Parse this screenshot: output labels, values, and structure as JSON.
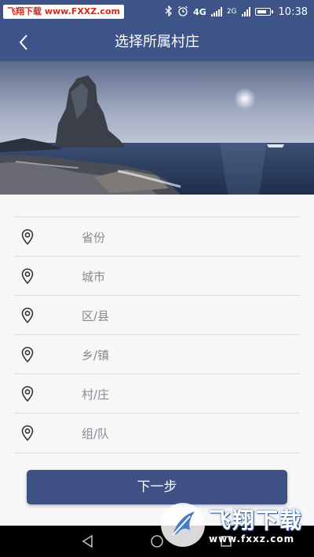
{
  "status_bar": {
    "watermark_app": "飞翔下载",
    "watermark_site": "www.FXXZ.com",
    "network_type": "4G",
    "network_sub": "2G",
    "time": "10:38"
  },
  "header": {
    "title": "选择所属村庄"
  },
  "form": {
    "rows": [
      {
        "label": "省份"
      },
      {
        "label": "城市"
      },
      {
        "label": "区/县"
      },
      {
        "label": "乡/镇"
      },
      {
        "label": "村/庄"
      },
      {
        "label": "组/队"
      }
    ]
  },
  "actions": {
    "next_label": "下一步"
  },
  "watermark": {
    "name": "飞翔下载",
    "url": "www.fxxz.com"
  },
  "colors": {
    "primary": "#3e5388",
    "button": "#3f5184",
    "divider": "#dcdce0",
    "label": "#8a8a8e"
  }
}
